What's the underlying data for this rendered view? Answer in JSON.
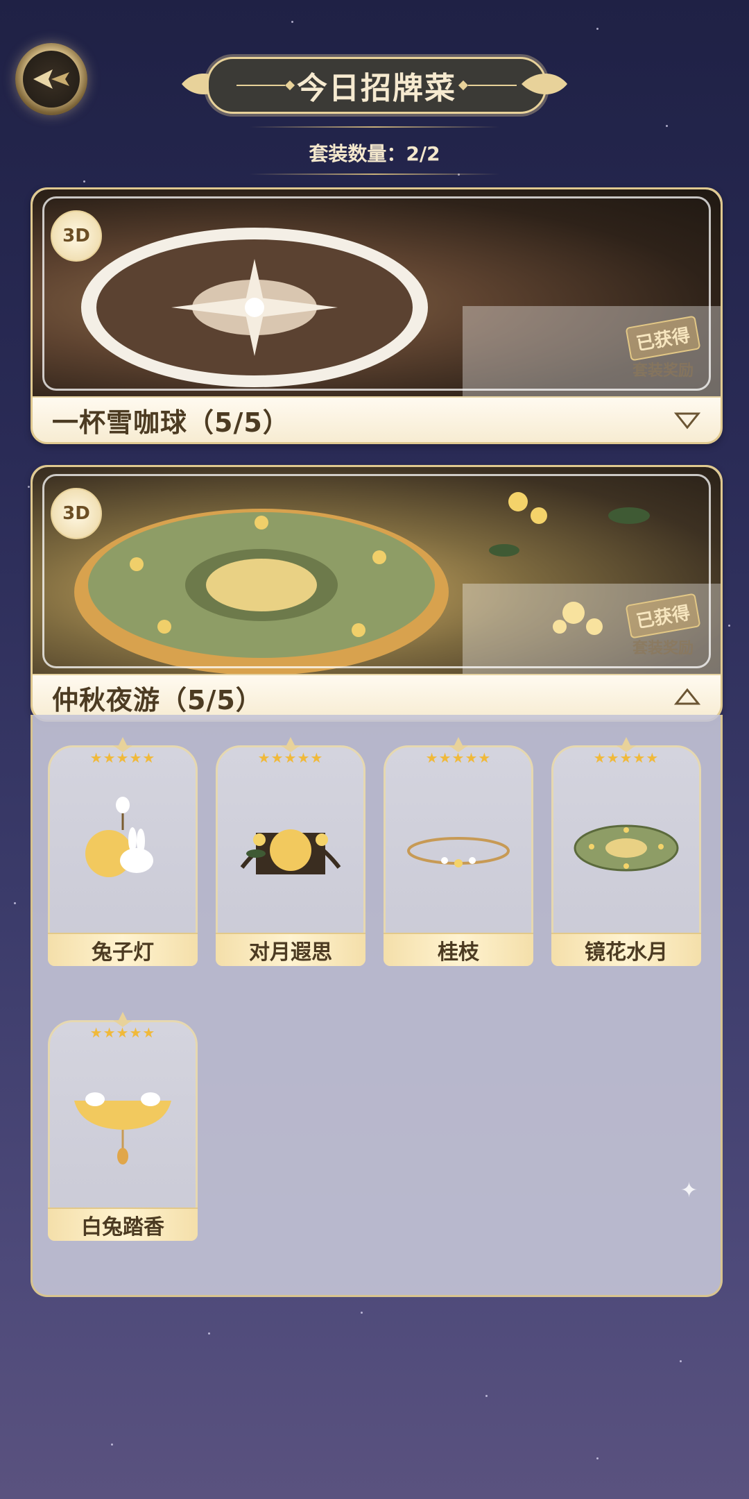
{
  "header": {
    "title": "今日招牌菜",
    "set_count": "套装数量：2/2"
  },
  "sets": [
    {
      "name": "一杯雪咖球（5/5）",
      "badge": "3D",
      "stamp_obtained": "已获得",
      "stamp_reward": "套装奖励",
      "expanded": false,
      "toggle_icon": "triangle-down-icon"
    },
    {
      "name": "仲秋夜游（5/5）",
      "badge": "3D",
      "stamp_obtained": "已获得",
      "stamp_reward": "套装奖励",
      "expanded": true,
      "toggle_icon": "triangle-up-icon",
      "items": [
        {
          "name": "兔子灯",
          "stars": "★★★★★"
        },
        {
          "name": "对月遐思",
          "stars": "★★★★★"
        },
        {
          "name": "桂枝",
          "stars": "★★★★★"
        },
        {
          "name": "镜花水月",
          "stars": "★★★★★"
        },
        {
          "name": "白兔踏香",
          "stars": "★★★★★"
        }
      ]
    }
  ],
  "colors": {
    "accent_gold": "#e0c98f",
    "plate_dark": "#3b3a36",
    "background_top": "#1f2145",
    "star_yellow": "#f0b93a"
  }
}
